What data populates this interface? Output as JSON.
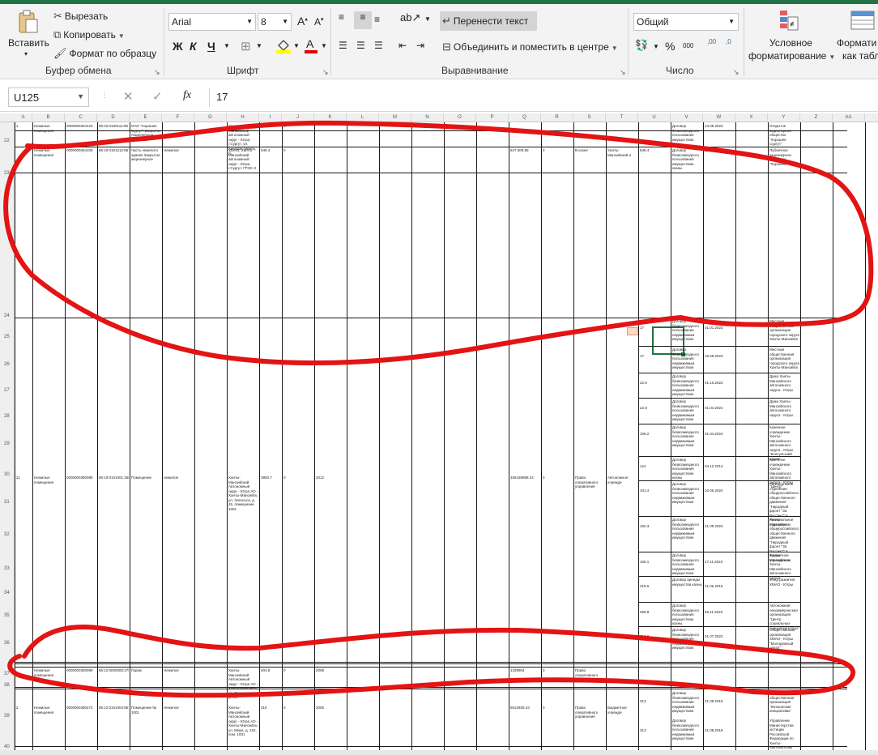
{
  "clipboard": {
    "paste_label": "Вставить",
    "cut_label": "Вырезать",
    "copy_label": "Копировать",
    "format_painter_label": "Формат по образцу",
    "group_label": "Буфер обмена"
  },
  "font": {
    "font_name": "Arial",
    "font_size": "8",
    "bold_label": "Ж",
    "italic_label": "К",
    "underline_label": "Ч",
    "group_label": "Шрифт"
  },
  "alignment": {
    "wrap_text_label": "Перенести текст",
    "merge_center_label": "Объединить и поместить в центре",
    "group_label": "Выравнивание"
  },
  "number": {
    "format_value": "Общий",
    "percent_label": "%",
    "thousands_label": "000",
    "increase_decimal_label": ",00",
    "decrease_decimal_label": ",0",
    "group_label": "Число"
  },
  "styles": {
    "conditional_line1": "Условное",
    "conditional_line2": "форматирование",
    "table_line1": "Формати",
    "table_line2": "как табл"
  },
  "formula_bar": {
    "name_box": "U125",
    "fx_label": "fx",
    "formula_value": "17"
  },
  "columns": [
    "A",
    "B",
    "C",
    "D",
    "E",
    "F",
    "G",
    "H",
    "I",
    "J",
    "K",
    "L",
    "M",
    "N",
    "O",
    "P",
    "Q",
    "R",
    "S",
    "T",
    "U",
    "V",
    "W",
    "X",
    "Y",
    "Z",
    "AA"
  ],
  "rows": [
    "22",
    "23",
    "24",
    "25",
    "26",
    "27",
    "28",
    "29",
    "30",
    "31",
    "32",
    "33",
    "34",
    "35",
    "36",
    "37",
    "38",
    "39",
    "40"
  ],
  "cells": {
    "r1_a": "1",
    "r1_b": "Нежилые помещения",
    "r1_c": "0000000364123",
    "r1_d": "86:22:0100112:96",
    "r1_e": "ОАО \"Хорошее Сургут\" Закрытое Акционерное общество",
    "r1_h": "Ханты-Мансийский автономный округ - Югра, г.Сургут, ул. Кинофестиваль, д.",
    "r1_i": "101.0",
    "r1_j": "0",
    "r1_v": "Договор безвозмездного пользования имуществом",
    "r1_w": "13.09.2023",
    "r1_y": "Открытое акционерное общество \"Хорошее Сургут\"",
    "r2_b": "Нежилые помещения",
    "r2_c": "0000000364109",
    "r2_d": "86:10:0101212:867",
    "r2_e": "Часть нежилого здания Закрытое акционерное",
    "r2_f": "Нежилое",
    "r2_h": "ХМАО, Ханты-Мансийский автономный округ - Югра, г.Сургут, ГРЭС-2",
    "r2_i": "848.4",
    "r2_j": "0",
    "r2_q": "847 509.69",
    "r2_r": "0",
    "r2_s": "В казне",
    "r2_t": "Ханты-Мансийский а",
    "r2_u": "848.4",
    "r2_v": "Договор безвозмездного пользования имуществом казны",
    "r2_w": "11.10.2023",
    "r2_y": "Публичное акционерное общество \"Хорошее\"",
    "m_a": "11",
    "m_b": "Нежилые помещения",
    "m_c": "0000000380088",
    "m_d": "86:10:0101001:2608",
    "m_e": "Помещение",
    "m_f": "нежилое",
    "m_h": "Ханты-Мансийский Автономный округ - Югра АО - Ханты-Мансийск, ул. Энгельса, д. 45, помещение 1001",
    "m_i": "3983.7",
    "m_j": "0",
    "m_k": "2012",
    "m_q": "336438988.24",
    "m_r": "0",
    "m_s": "Право оперативного управления",
    "m_t": "Автономное учрежде",
    "sub": [
      {
        "u": "17",
        "v": "Договор безвозмездного пользования недвижимым имуществом",
        "w": "01.01.2023",
        "y": "Местная общественная организация городского округа Ханты-Мансийск"
      },
      {
        "u": "17",
        "v": "Договор безвозмездного пользования недвижимым имуществом",
        "w": "16.09.2023",
        "y": "Местная общественная организация городского округа Ханты-Мансийск"
      },
      {
        "u": "22.8",
        "v": "Договор безвозмездного пользования недвижимым имуществом",
        "w": "01.10.2022",
        "y": "Дума Ханты-Мансийского автономного округа - Югры"
      },
      {
        "u": "22.8",
        "v": "Договор безвозмездного пользования недвижимым имуществом",
        "w": "01.04.2024",
        "y": "Дума Ханты-Мансийского автономного округа - Югры"
      },
      {
        "u": "106.2",
        "v": "Договор безвозмездного пользования недвижимым имуществом",
        "w": "01.04.2024",
        "y": "Казенное учреждение Ханты-Мансийского автономного округа - Югры \"Консульский архив\""
      },
      {
        "u": "124",
        "v": "Договор безвозмездного пользования имуществом казны",
        "w": "04.12.2014",
        "y": "Казенное учреждение Ханты-Мансийского автономного округа - Югры \"Центр\""
      },
      {
        "u": "101.4",
        "v": "Договор безвозмездного пользования недвижимым имуществом",
        "w": "10.06.2024",
        "y": "Региональное отделение общероссийского общественного движения \"Народный фронт \"За Россию\"\" в Ханты-Мансийском"
      },
      {
        "u": "182.3",
        "v": "Договор безвозмездного пользования недвижимым имуществом",
        "w": "21.09.2024",
        "y": "Региональное отделение общероссийского общественного движения \"Народный фронт \"За Россию\"\" в Ханты-Мансийском"
      },
      {
        "u": "160.1",
        "v": "Договор безвозмездного пользования недвижимым имуществом",
        "w": "17.11.2023",
        "y": "Бюджетное учреждение Ханты-Мансийского автономного округа"
      },
      {
        "u": "218.6",
        "v": "Договор аренды имущества казны",
        "w": "21.06.2016",
        "y": "Фонд развития ХМАО - Югры"
      },
      {
        "u": "289.8",
        "v": "Договор безвозмездного пользования имуществом казны",
        "w": "28.11.2023",
        "y": "Автономная некоммерческая организация \"Центр социальных инициатив Югры\""
      },
      {
        "u": "310.0",
        "v": "Договор безвозмездного пользования недвижимым имуществом",
        "w": "01.07.2022",
        "y": "Общественная организация ХМАО - Югры \"Молодежный центр\""
      }
    ],
    "r36_b": "Нежилые помещения",
    "r36_c": "0000000380099",
    "r36_d": "86:12:0000000:2790",
    "r36_e": "Гараж",
    "r36_f": "Нежилое",
    "r36_h": "Ханты-Мансийский Автономный округ - Югра АО - Ханты-Мансийск, ул. Пионерская, д. 31,",
    "r36_i": "404.8",
    "r36_j": "0",
    "r36_k": "2008",
    "r36_q": "1339904",
    "r36_r": "0",
    "r36_s": "Право оперативного управления",
    "r38_a": "2",
    "r38_b": "Нежилые помещения",
    "r38_c": "0000000380272",
    "r38_d": "86:12:0101004:851",
    "r38_e": "Помещение № 1001",
    "r38_f": "Нежилое",
    "r38_h": "Ханты-Мансийский Автономный округ - Югра АО - Ханты-Мансийск, ул. Мира, д. 104, пом. 1001",
    "r38_i": "315",
    "r38_j": "0",
    "r38_k": "2005",
    "r38_q": "5613928.43",
    "r38_r": "0",
    "r38_s": "Право оперативного управления",
    "r38_t": "Бюджетное учрежде",
    "r38_u1": "313",
    "r38_v1": "Договор безвозмездного пользования недвижимым имуществом",
    "r38_w1": "21.08.2019",
    "r38_y1": "Региональная общественная организация \"Юношеские инициативы\"",
    "r38_u2": "313",
    "r38_v2": "Договор безвозмездного пользования недвижимым имуществом",
    "r38_w2": "21.08.2019",
    "r38_y2": "Управление Министерства юстиции Российской Федерации по Ханты-Мансийскому"
  },
  "colors": {
    "accent": "#217346",
    "annotation": "#e31414",
    "grid": "#1a1a1a"
  }
}
